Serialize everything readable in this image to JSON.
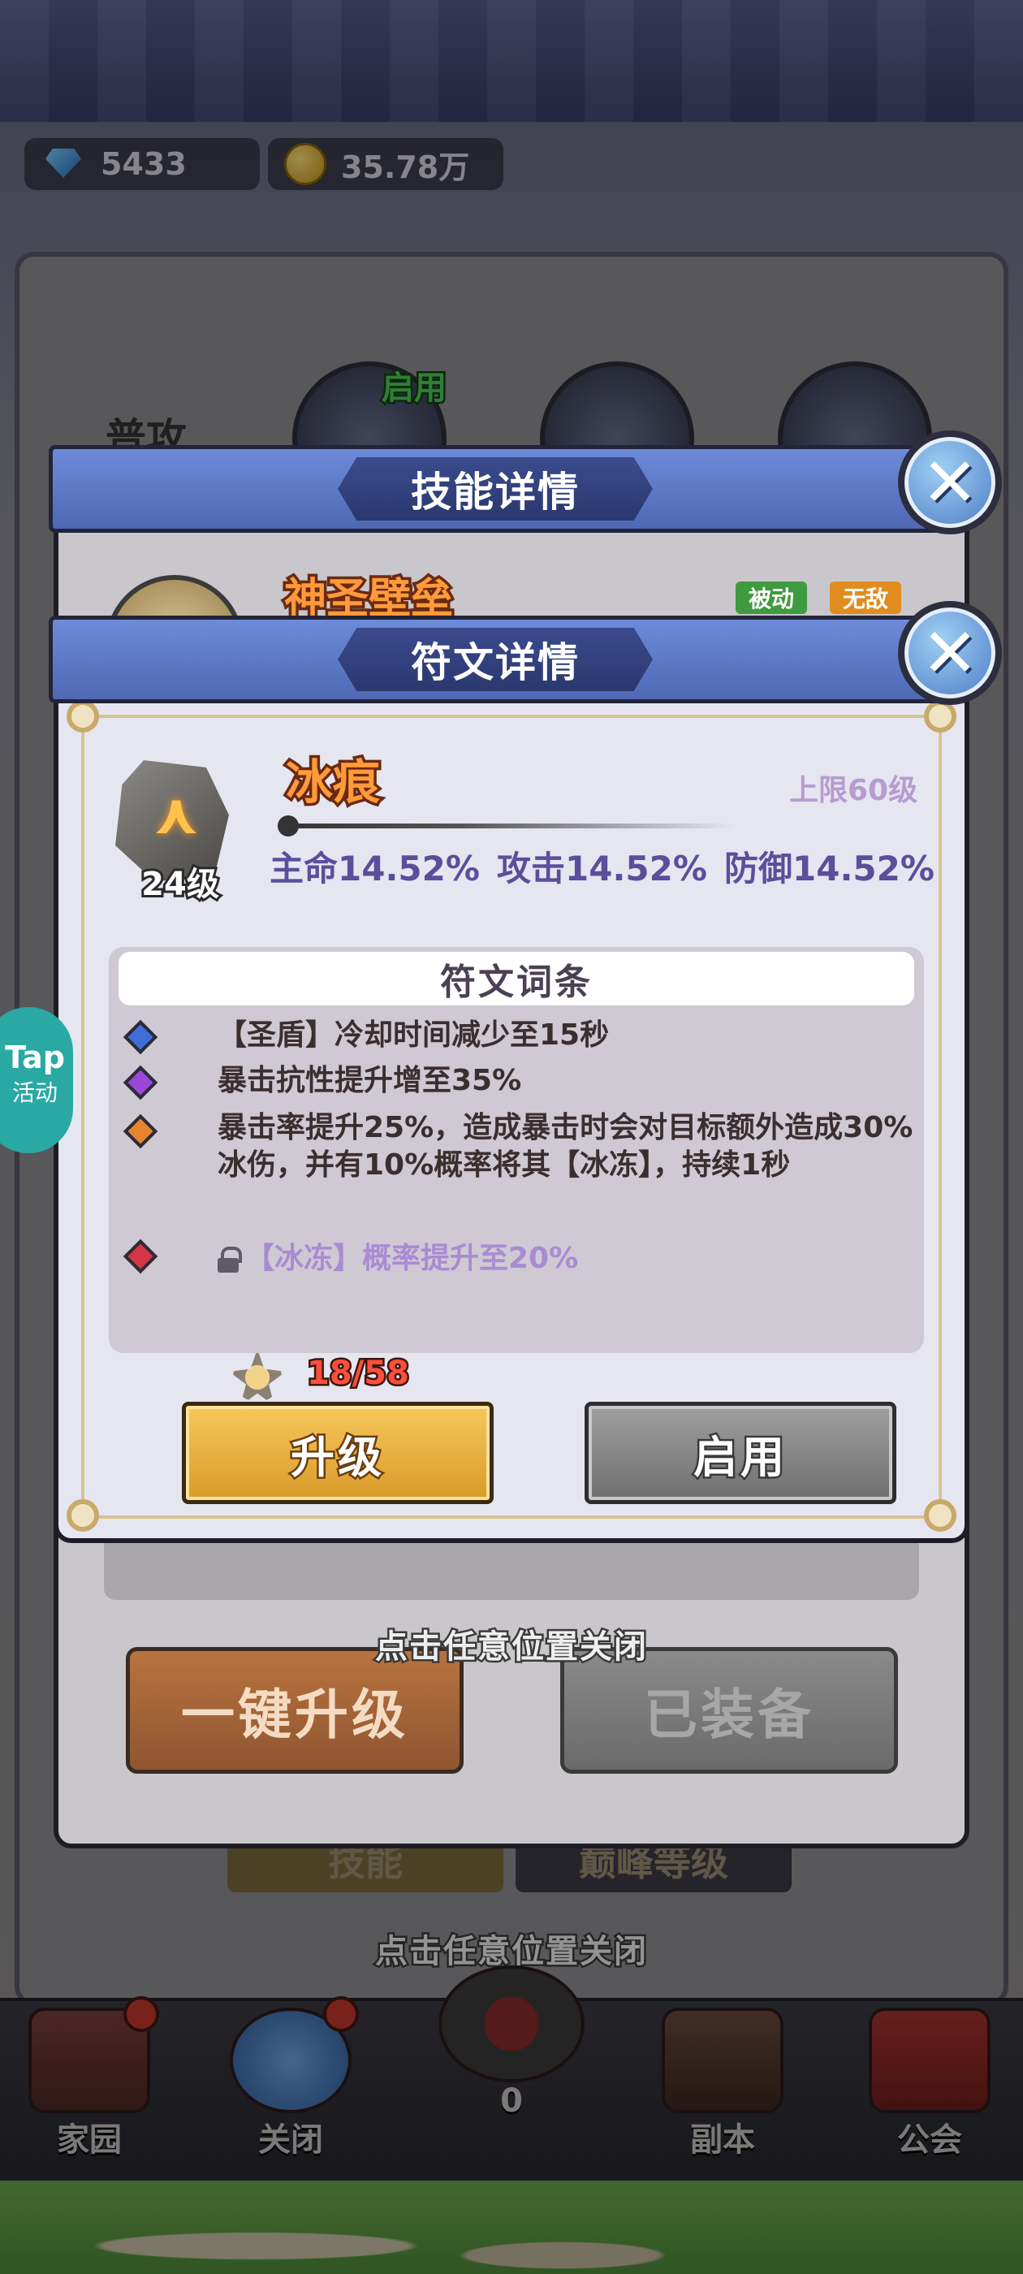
{
  "top": {
    "gems": "5433",
    "gold": "35.78万"
  },
  "background": {
    "attack_label": "普攻",
    "enabled_tag": "启用",
    "tab_skill": "技能",
    "tab_peak": "巅峰等级",
    "close_hint": "点击任意位置关闭"
  },
  "bottom_nav": {
    "items": [
      {
        "label": "家园"
      },
      {
        "label": "关闭"
      },
      {
        "label": "0"
      },
      {
        "label": "副本"
      },
      {
        "label": "公会"
      }
    ]
  },
  "side_badge": {
    "line1": "Tap",
    "line2": "活动"
  },
  "skill_popup": {
    "title": "技能详情",
    "skill_name": "神圣壁垒",
    "tags": [
      "被动",
      "无敌"
    ],
    "one_click_upgrade": "一键升级",
    "equipped": "已装备",
    "close_hint": "点击任意位置关闭"
  },
  "rune_popup": {
    "title": "符文详情",
    "rune_name": "冰痕",
    "rune_level": "24级",
    "max_level": "上限60级",
    "stats": [
      "主命14.52%",
      "攻击14.52%",
      "防御14.52%"
    ],
    "affix_title": "符文词条",
    "affixes": [
      {
        "text": "【圣盾】冷却时间减少至15秒",
        "color": "#3f6fd6",
        "locked": false
      },
      {
        "text": "暴击抗性提升增至35%",
        "color": "#9b47d9",
        "locked": false
      },
      {
        "text": "暴击率提升25%，造成暴击时会对目标额外造成30%冰伤，并有10%概率将其【冰冻】，持续1秒",
        "color": "#e7852f",
        "locked": false
      },
      {
        "text": "【冰冻】概率提升至20%",
        "color": "#d53545",
        "locked": true
      }
    ],
    "material_count": "18/58",
    "upgrade_button": "升级",
    "enable_button": "启用",
    "close_hint": "点击任意位置关闭"
  },
  "colors": {
    "header_blue": "#5a74c4",
    "gold_button": "#e8b043",
    "gray_button": "#888888",
    "rune_name": "#ff9a3b"
  }
}
